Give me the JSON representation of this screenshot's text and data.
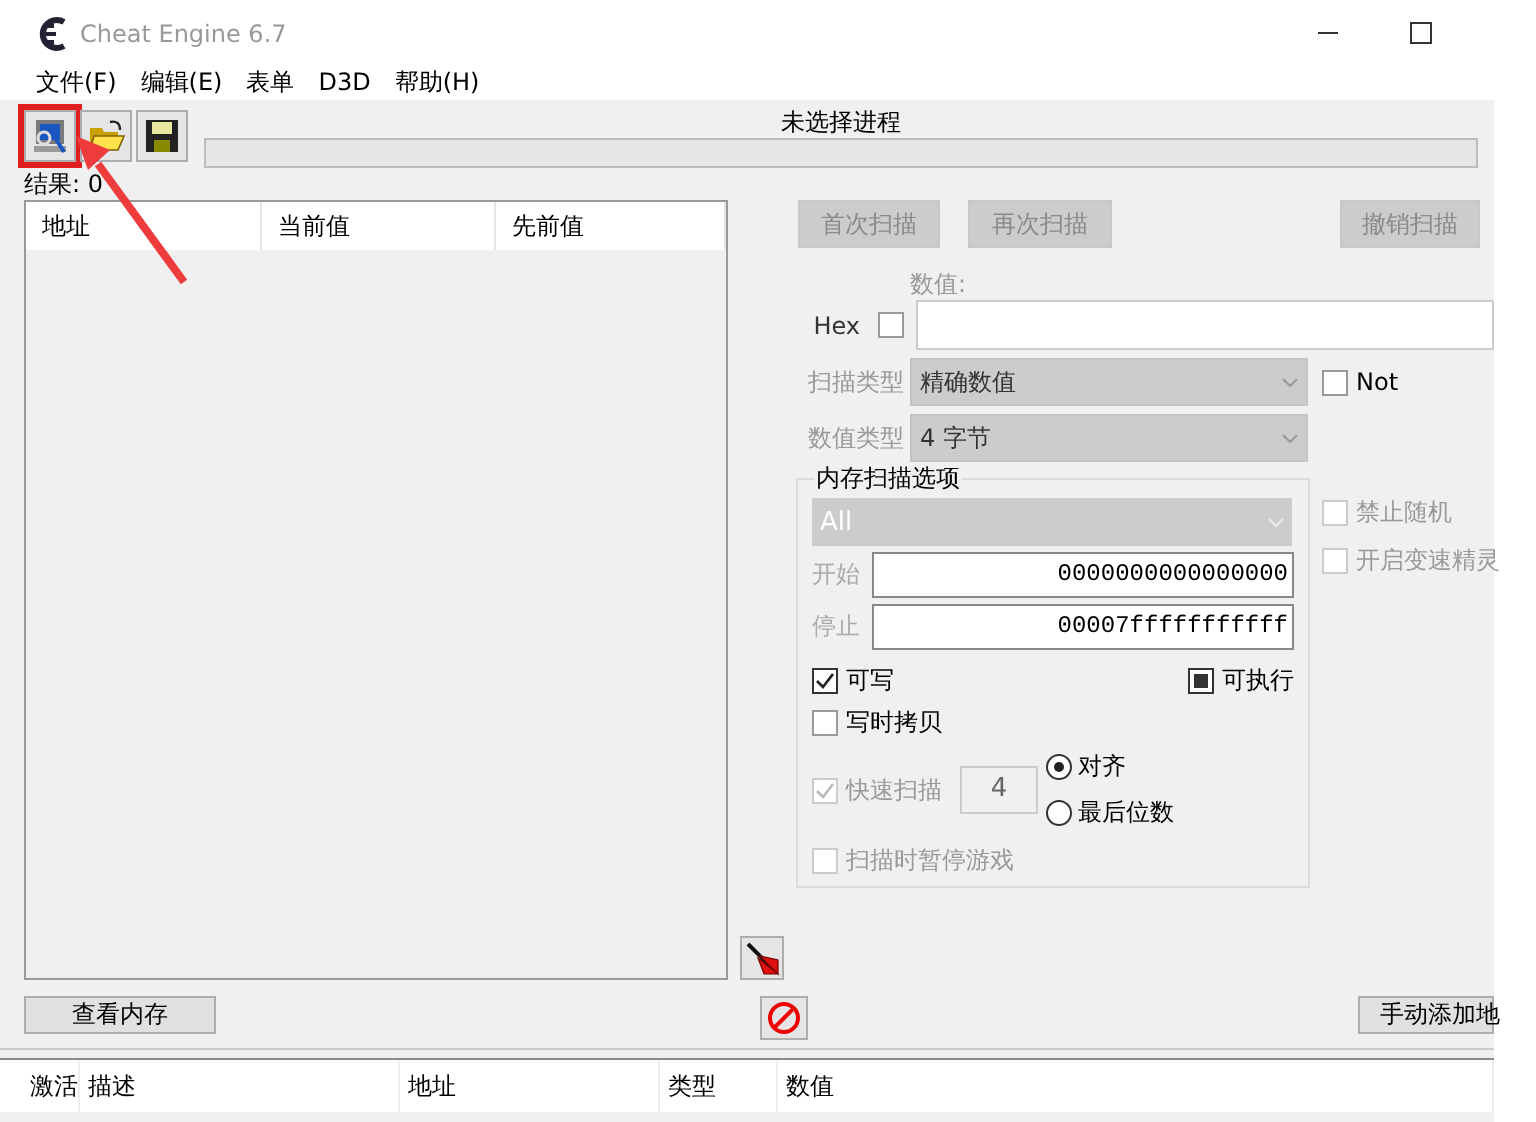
{
  "window": {
    "title": "Cheat Engine 6.7"
  },
  "menu": [
    {
      "label": "文件(F)"
    },
    {
      "label": "编辑(E)"
    },
    {
      "label": "表单"
    },
    {
      "label": "D3D"
    },
    {
      "label": "帮助(H)"
    }
  ],
  "toolbar": {
    "buttons": [
      {
        "kind": "process",
        "highlighted": true
      },
      {
        "kind": "open",
        "highlighted": false
      },
      {
        "kind": "save",
        "highlighted": false
      }
    ],
    "process_label": "未选择进程",
    "progress": {
      "level": 0
    }
  },
  "results": "结果: 0",
  "found_list": {
    "columns": [
      "地址",
      "当前值",
      "先前值"
    ]
  },
  "scan_buttons": [
    {
      "label": "首次扫描",
      "disabled": true
    },
    {
      "label": "再次扫描",
      "disabled": true
    },
    {
      "label": "撤销扫描",
      "disabled": true
    }
  ],
  "value": {
    "label": "数值:",
    "hex_label": "Hex",
    "hex_checked": false
  },
  "scan_type": {
    "label": "扫描类型",
    "value": "精确数值",
    "not_label": "Not",
    "not_checked": false
  },
  "value_type": {
    "label": "数值类型",
    "value": "4 字节"
  },
  "memory_options": {
    "title": "内存扫描选项",
    "region": "All",
    "start_label": "开始",
    "start": "0000000000000000",
    "stop_label": "停止",
    "stop": "00007fffffffffff",
    "flags": [
      {
        "label": "可写",
        "kind": "check",
        "checked": true
      },
      {
        "label": "可执行",
        "kind": "tristate",
        "checked": true
      },
      {
        "label": "写时拷贝",
        "kind": "check",
        "checked": false
      }
    ],
    "fast_scan": {
      "label": "快速扫描",
      "checked": true,
      "disabled": true,
      "value": "4"
    },
    "alignment": [
      {
        "label": "对齐",
        "selected": true
      },
      {
        "label": "最后位数",
        "selected": false
      }
    ],
    "pause": {
      "label": "扫描时暂停游戏",
      "checked": false,
      "disabled": true
    }
  },
  "side_options": [
    {
      "label": "禁止随机",
      "checked": false
    },
    {
      "label": "开启变速精灵",
      "checked": false
    }
  ],
  "bottom": {
    "view_memory": "查看内存",
    "add_address": "手动添加地"
  },
  "cheat_table": {
    "columns": [
      "激活",
      "描述",
      "地址",
      "类型",
      "数值"
    ]
  }
}
